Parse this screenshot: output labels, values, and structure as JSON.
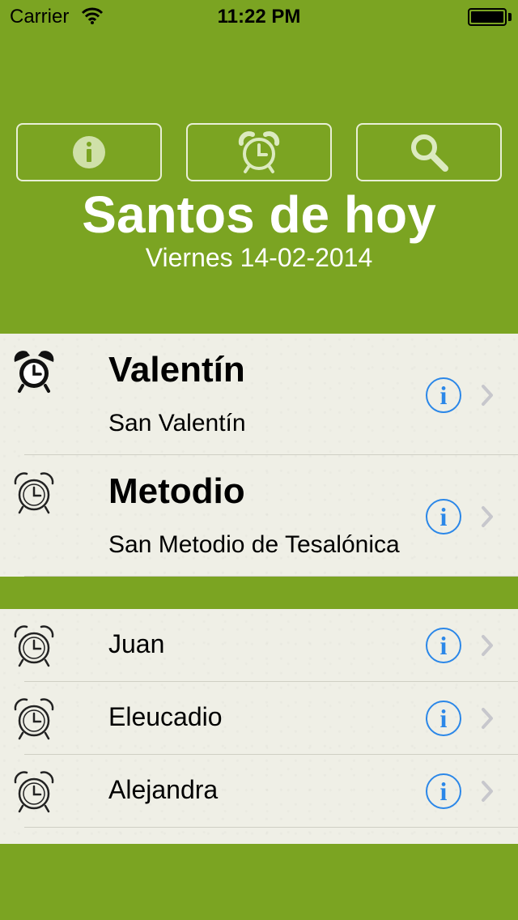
{
  "status_bar": {
    "carrier": "Carrier",
    "time": "11:22 PM"
  },
  "header": {
    "title": "Santos de hoy",
    "date": "Viernes 14-02-2014",
    "buttons": [
      {
        "icon": "info-icon"
      },
      {
        "icon": "alarm-clock-icon"
      },
      {
        "icon": "search-icon"
      }
    ]
  },
  "featured_saints": [
    {
      "name": "Valentín",
      "full_name": "San Valentín",
      "alarm_active": true
    },
    {
      "name": "Metodio",
      "full_name": "San Metodio de Tesalónica",
      "alarm_active": false
    }
  ],
  "other_saints": [
    {
      "name": "Juan",
      "alarm_active": false
    },
    {
      "name": "Eleucadio",
      "alarm_active": false
    },
    {
      "name": "Alejandra",
      "alarm_active": false
    }
  ],
  "colors": {
    "background": "#7ba422",
    "list_background": "#efefe6",
    "info_accent": "#2b87e8",
    "chevron": "#c7c7cc"
  },
  "info_label": "i"
}
